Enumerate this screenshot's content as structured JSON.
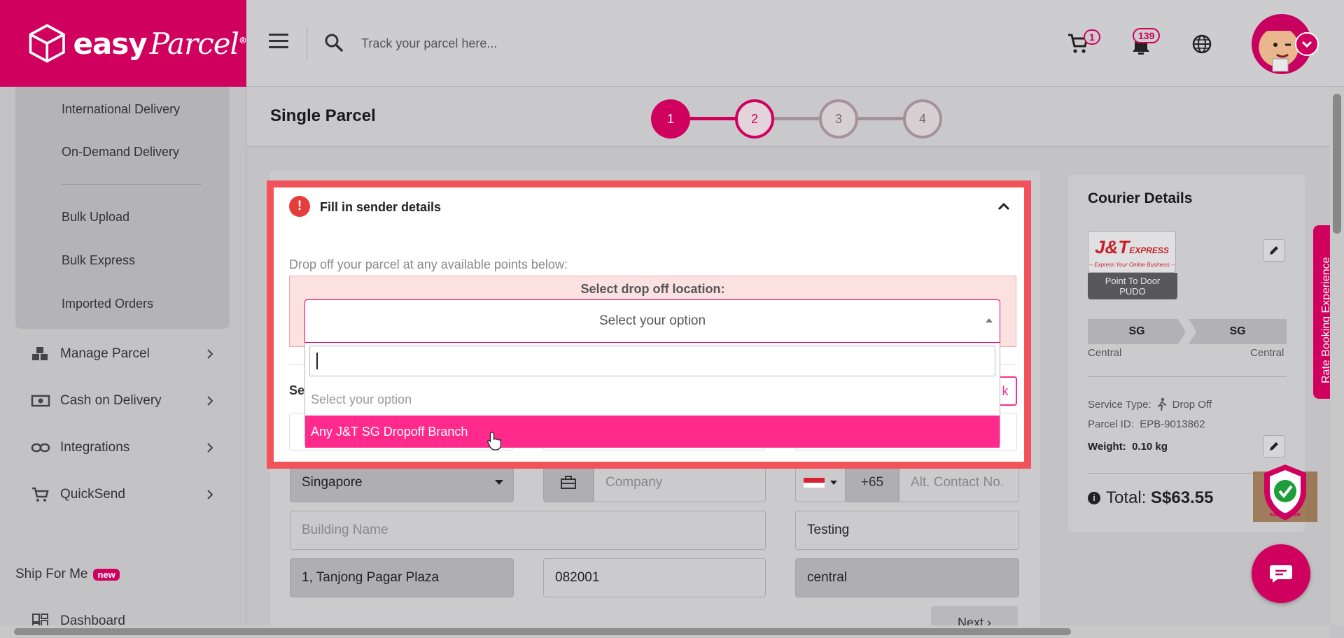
{
  "brand": {
    "name_bold": "easy",
    "name_script": "Parcel",
    "registered": "®",
    "color": "#d0005e"
  },
  "header": {
    "search_placeholder": "Track your parcel here...",
    "cart_count": "1",
    "notification_count": "139",
    "icons": [
      "menu-icon",
      "search-icon",
      "cart-icon",
      "notification-icon",
      "globe-icon",
      "avatar",
      "chevron-down-icon"
    ]
  },
  "sidebar": {
    "submenu": [
      "International Delivery",
      "On-Demand Delivery",
      "Bulk Upload",
      "Bulk Express",
      "Imported Orders"
    ],
    "menu": [
      {
        "label": "Manage Parcel",
        "icon": "boxes-icon"
      },
      {
        "label": "Cash on Delivery",
        "icon": "cash-icon"
      },
      {
        "label": "Integrations",
        "icon": "link-icon"
      },
      {
        "label": "QuickSend",
        "icon": "cart-add-icon"
      }
    ],
    "ship_for_me": "Ship For Me",
    "new_badge": "new",
    "dashboard": "Dashboard"
  },
  "page": {
    "title": "Single Parcel",
    "steps": [
      "1",
      "2",
      "3",
      "4"
    ]
  },
  "sender": {
    "section_title": "Fill in sender details",
    "dropoff_hint": "Drop off your parcel at any available points below:",
    "dropoff_label": "Select drop off location:",
    "select_value": "Select your option",
    "options": [
      "Select your option",
      "Any J&T SG Dropoff Branch"
    ],
    "partial_label": "Se",
    "partial_button": "k"
  },
  "form": {
    "country": "Singapore",
    "company_placeholder": "Company",
    "phone_prefix": "+65",
    "alt_contact_placeholder": "Alt. Contact No.",
    "building_placeholder": "Building Name",
    "name_value": "Testing",
    "address_value": "1, Tanjong Pagar Plaza",
    "postcode_value": "082001",
    "region_value": "central",
    "next_label": "Next"
  },
  "courier": {
    "title": "Courier Details",
    "logo_text": "J&T",
    "logo_sub": "EXPRESS",
    "logo_tagline": "-- Express Your Online Business --",
    "service_line1": "Point To Door",
    "service_line2": "PUDO",
    "from_country": "SG",
    "to_country": "SG",
    "from_region": "Central",
    "to_region": "Central",
    "service_type_label": "Service Type:",
    "service_type_value": "Drop Off",
    "parcel_id_label": "Parcel ID:",
    "parcel_id_value": "EPB-9013862",
    "weight_label": "Weight:",
    "weight_value": "0.10 kg",
    "total_label": "Total:",
    "total_value": "S$63.55",
    "easycover": "EASYCOVER"
  },
  "rate_tab": "Rate Booking Experience"
}
